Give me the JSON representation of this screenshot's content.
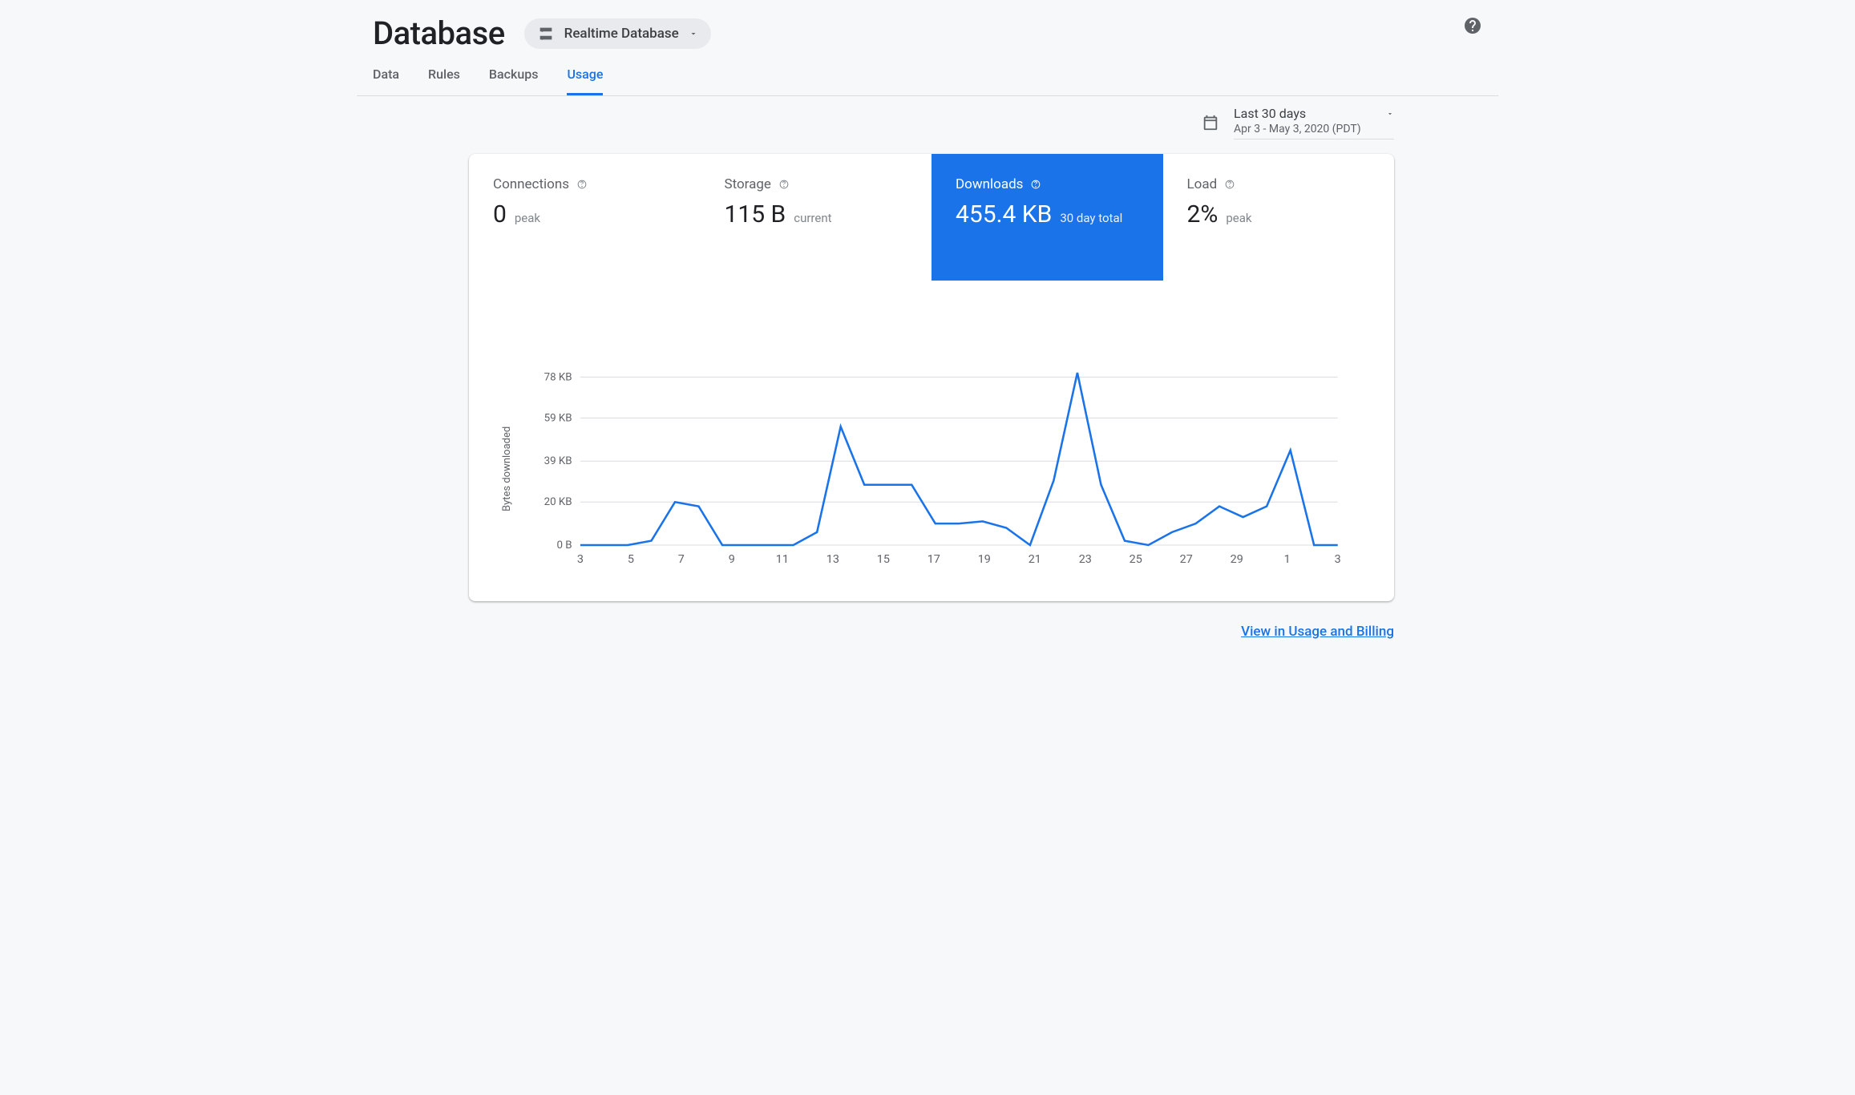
{
  "header": {
    "title": "Database",
    "selector_label": "Realtime Database"
  },
  "tabs": [
    {
      "label": "Data",
      "active": false
    },
    {
      "label": "Rules",
      "active": false
    },
    {
      "label": "Backups",
      "active": false
    },
    {
      "label": "Usage",
      "active": true
    }
  ],
  "date": {
    "label": "Last 30 days",
    "range": "Apr 3 - May 3, 2020 (PDT)"
  },
  "stats": [
    {
      "title": "Connections",
      "value": "0",
      "sub": "peak",
      "active": false
    },
    {
      "title": "Storage",
      "value": "115 B",
      "sub": "current",
      "active": false
    },
    {
      "title": "Downloads",
      "value": "455.4 KB",
      "sub": "30 day total",
      "active": true
    },
    {
      "title": "Load",
      "value": "2%",
      "sub": "peak",
      "active": false
    }
  ],
  "chart_data": {
    "type": "line",
    "title": "",
    "xlabel": "",
    "ylabel": "Bytes downloaded",
    "ylim": [
      0,
      80
    ],
    "y_ticks": [
      "0 B",
      "20 KB",
      "39 KB",
      "59 KB",
      "78 KB"
    ],
    "x_ticks": [
      "3",
      "5",
      "7",
      "9",
      "11",
      "13",
      "15",
      "17",
      "19",
      "21",
      "23",
      "25",
      "27",
      "29",
      "1",
      "3"
    ],
    "x": [
      3,
      4,
      5,
      6,
      7,
      8,
      9,
      10,
      11,
      12,
      13,
      14,
      15,
      16,
      17,
      18,
      19,
      20,
      21,
      22,
      23,
      24,
      25,
      26,
      27,
      28,
      29,
      30,
      1,
      2,
      3
    ],
    "values": [
      0,
      0,
      0,
      2,
      20,
      18,
      0,
      0,
      0,
      0,
      6,
      55,
      28,
      28,
      28,
      10,
      10,
      11,
      8,
      0,
      30,
      80,
      28,
      2,
      0,
      6,
      10,
      18,
      13,
      18,
      44,
      0,
      0
    ]
  },
  "footer": {
    "link_label": "View in Usage and Billing"
  }
}
